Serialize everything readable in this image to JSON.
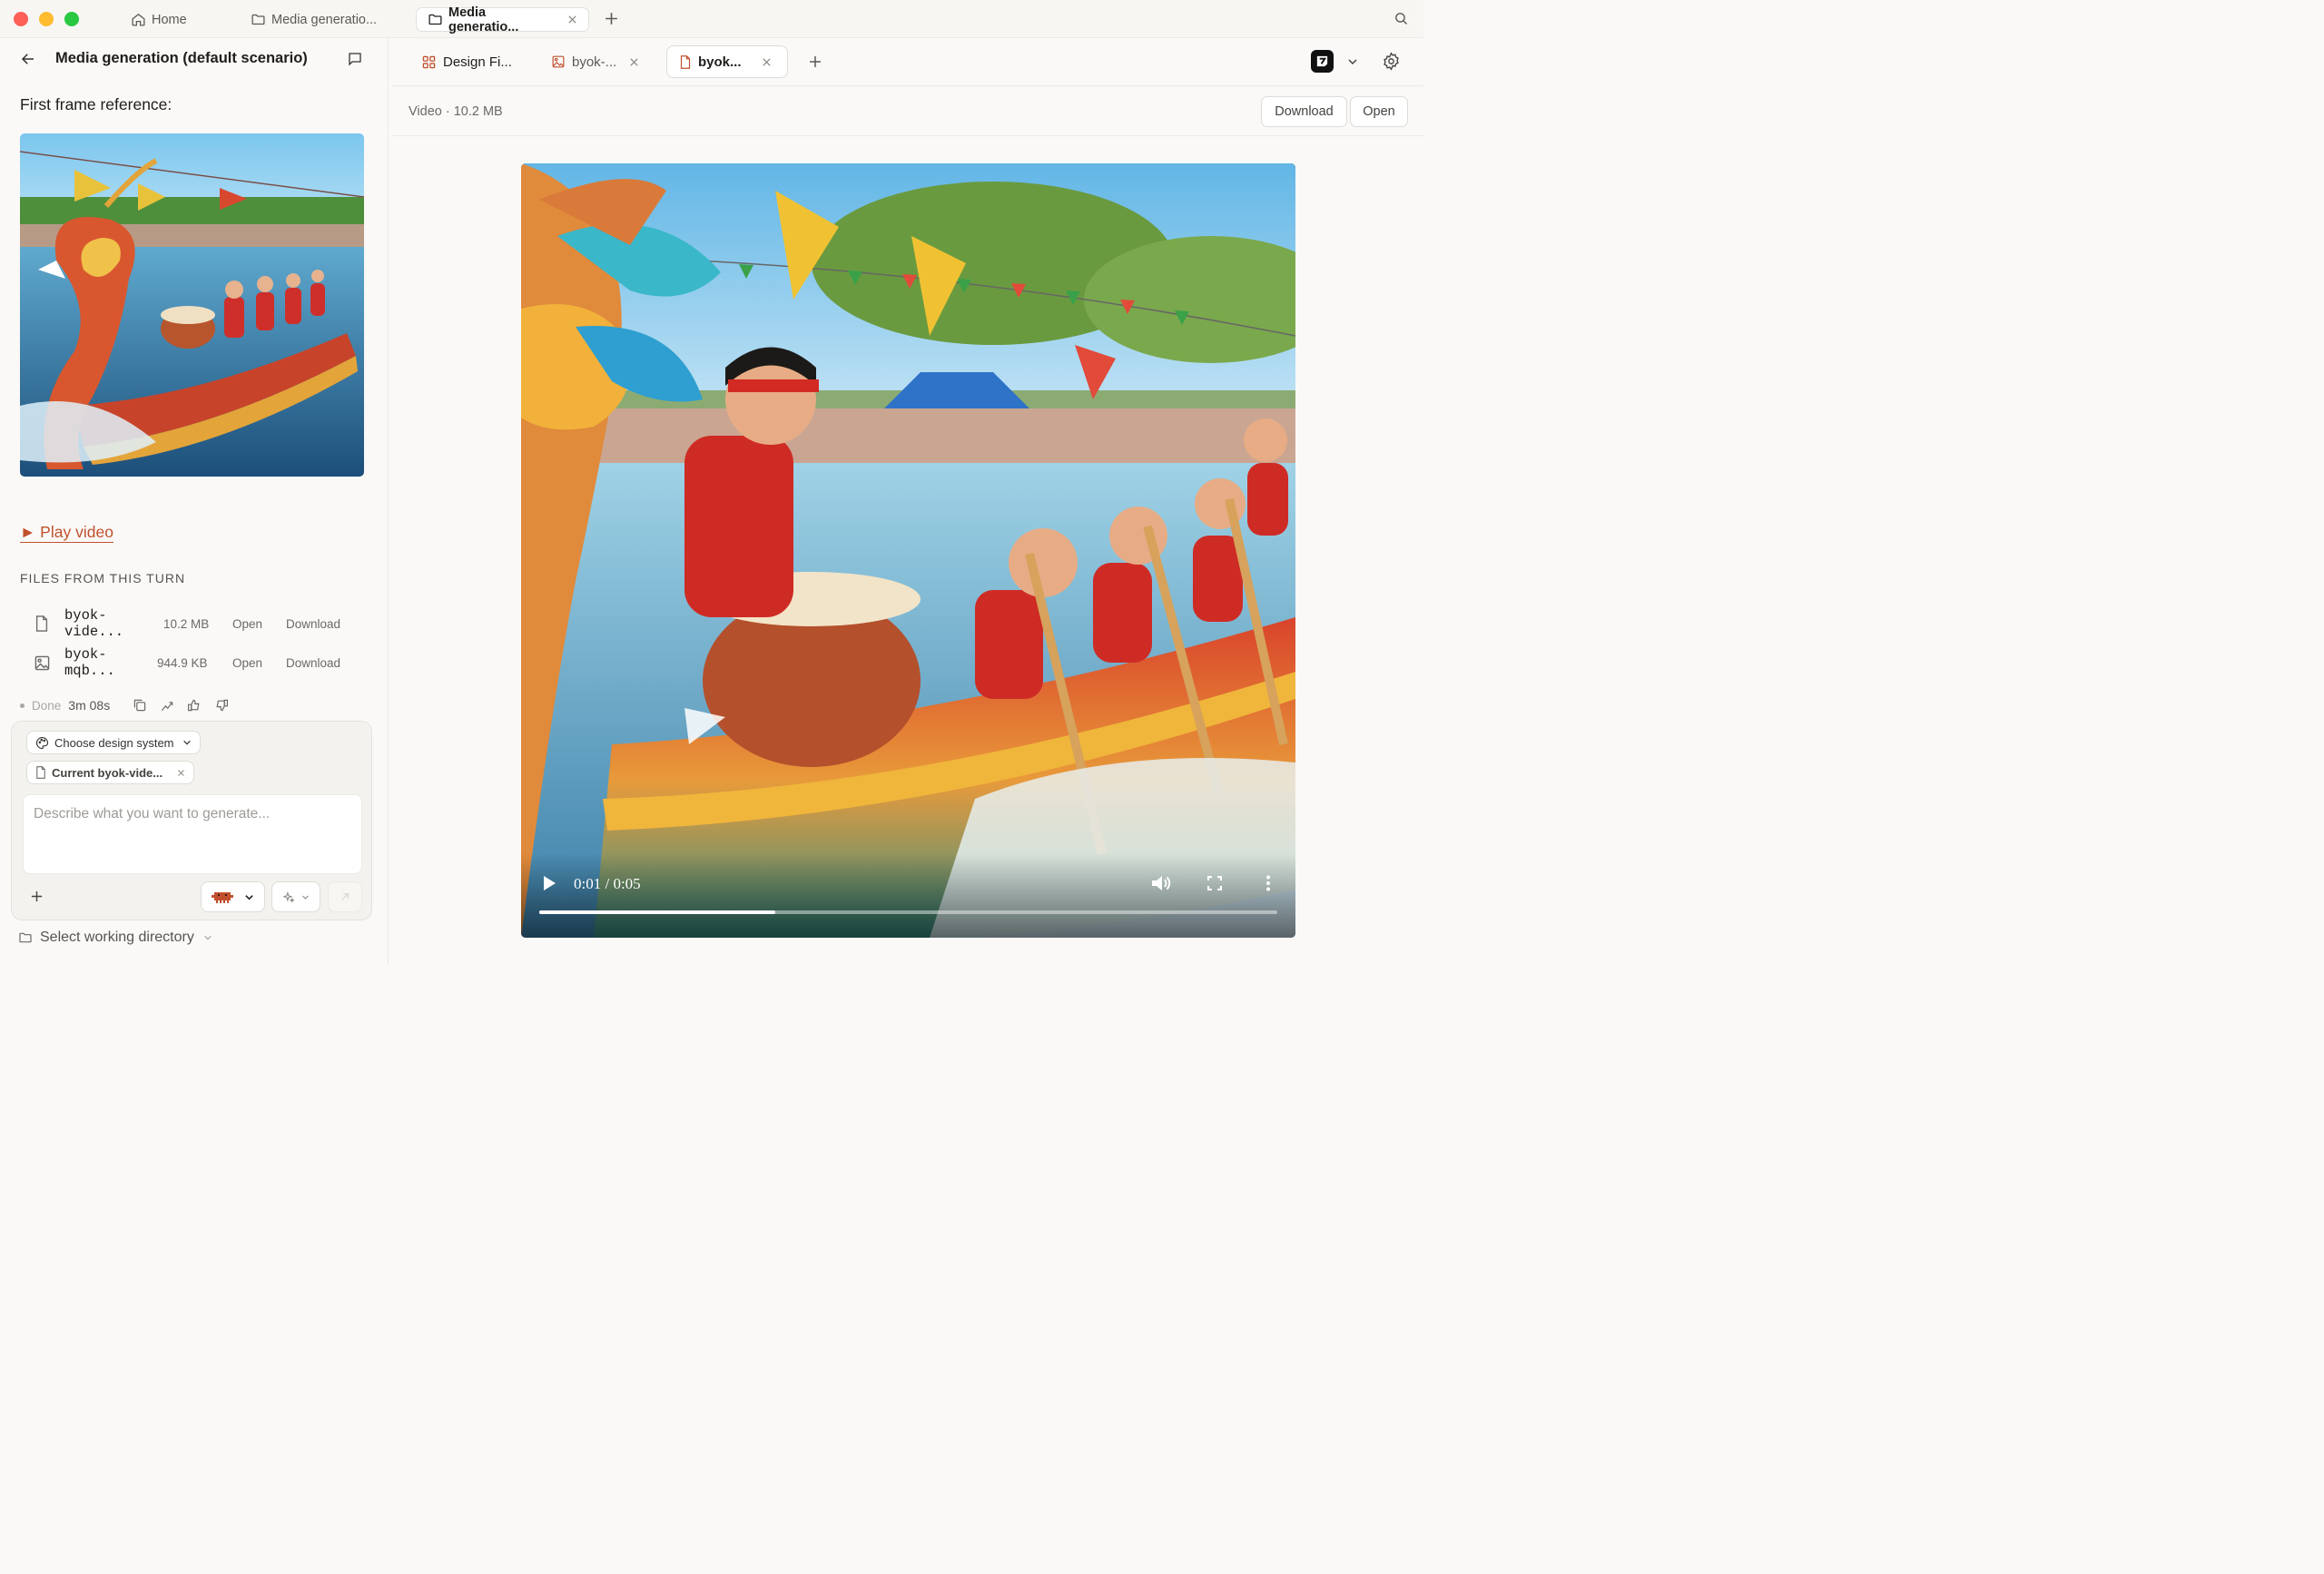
{
  "window_tabs": [
    {
      "label": "Home",
      "icon": "home-icon"
    },
    {
      "label": "Media generatio...",
      "icon": "folder-icon"
    },
    {
      "label": "Media generatio...",
      "icon": "folder-icon",
      "active": true
    }
  ],
  "chat": {
    "title": "Media generation (default scenario)",
    "first_frame_label": "First frame reference:",
    "play_video": "► Play video",
    "files_heading": "FILES FROM THIS TURN",
    "files": [
      {
        "name": "byok-vide...",
        "size": "10.2 MB",
        "open": "Open",
        "download": "Download",
        "icon": "file-icon"
      },
      {
        "name": "byok-mqb...",
        "size": "944.9 KB",
        "open": "Open",
        "download": "Download",
        "icon": "image-file-icon"
      }
    ],
    "status": "Done",
    "duration": "3m 08s"
  },
  "composer": {
    "design_system": "Choose design system",
    "attachment": "Current byok-vide...",
    "placeholder": "Describe what you want to generate...",
    "working_directory": "Select working directory"
  },
  "preview": {
    "tabs": [
      {
        "label": "Design Fi...",
        "icon": "grid-icon"
      },
      {
        "label": "byok-...",
        "icon": "image-file-icon"
      },
      {
        "label": "byok...",
        "icon": "file-icon",
        "active": true
      }
    ],
    "meta": "Video · 10.2 MB",
    "download_label": "Download",
    "open_label": "Open",
    "player": {
      "time": "0:01 / 0:05",
      "progress": 0.32
    }
  },
  "colors": {
    "accent": "#c1502e",
    "traffic_red": "#fe5f57",
    "traffic_yellow": "#febc2e",
    "traffic_green": "#28c840"
  }
}
